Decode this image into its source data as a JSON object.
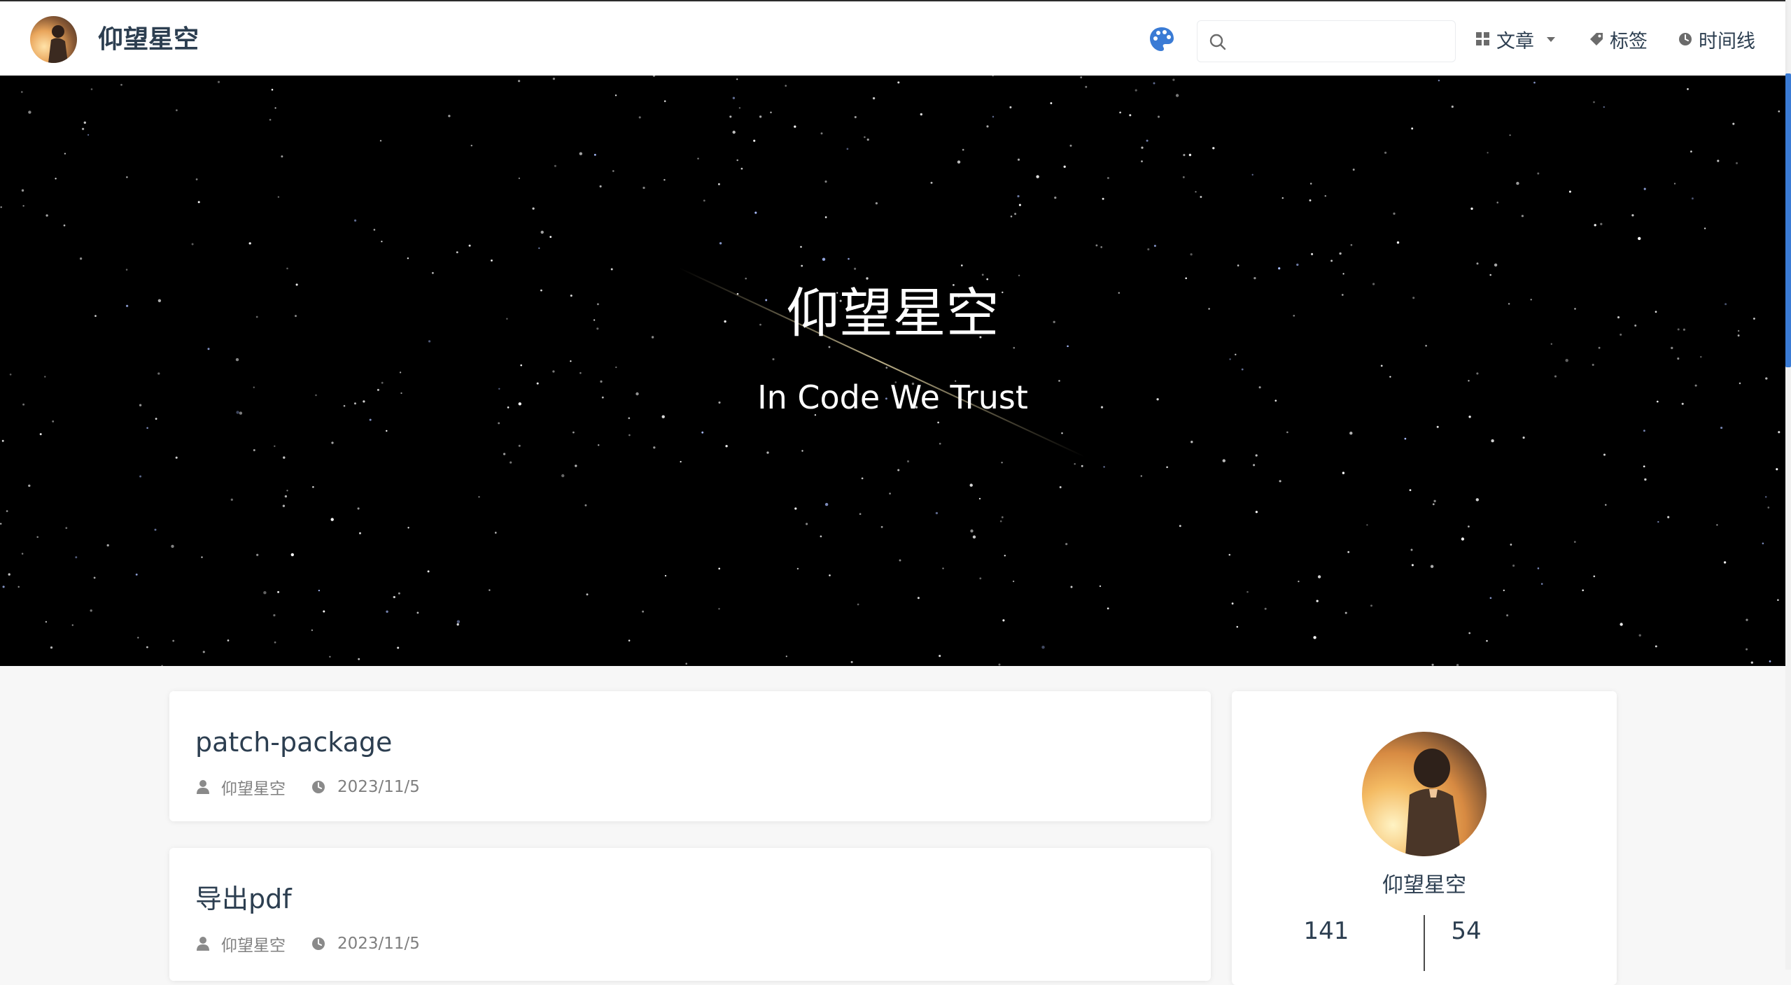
{
  "header": {
    "site_name": "仰望星空",
    "search": {
      "value": "",
      "placeholder": ""
    },
    "nav": {
      "articles": "文章",
      "tags": "标签",
      "timeline": "时间线"
    },
    "icons": [
      "palette-icon",
      "search-icon",
      "grid-icon",
      "chevron-down-icon",
      "tag-icon",
      "clock-icon"
    ],
    "accent_color": "#3a7bd5"
  },
  "hero": {
    "title": "仰望星空",
    "subtitle": "In Code We Trust"
  },
  "posts": [
    {
      "title": "patch-package",
      "author": "仰望星空",
      "date": "2023/11/5"
    },
    {
      "title": "导出pdf",
      "author": "仰望星空",
      "date": "2023/11/5"
    }
  ],
  "profile": {
    "name": "仰望星空",
    "articles_count": "141",
    "tags_count": "54"
  }
}
